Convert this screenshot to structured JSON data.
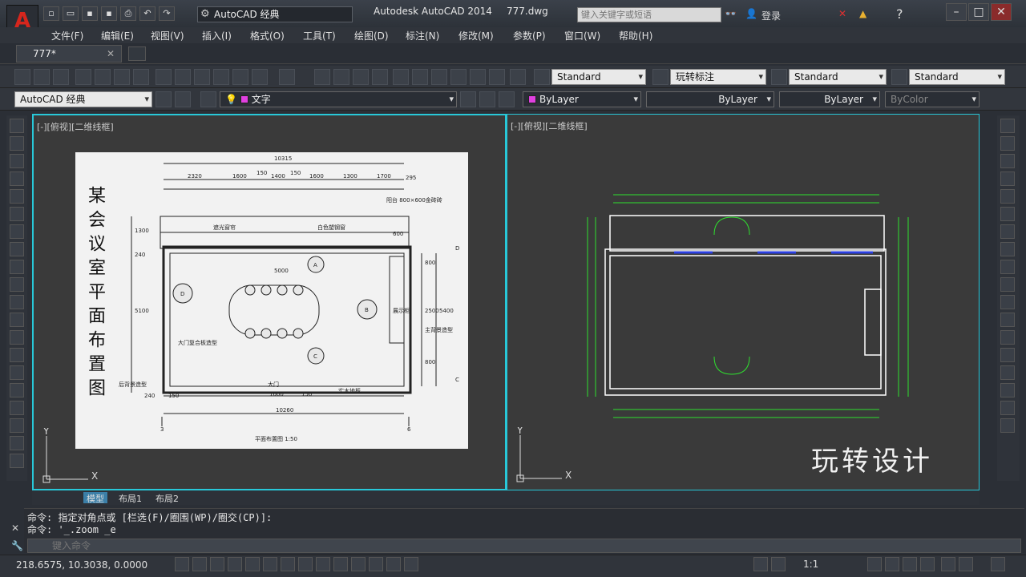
{
  "title": {
    "app": "Autodesk AutoCAD 2014",
    "file": "777.dwg"
  },
  "workspace": "AutoCAD 经典",
  "search": {
    "placeholder": "键入关键字或短语"
  },
  "login": "登录",
  "menu": [
    "文件(F)",
    "编辑(E)",
    "视图(V)",
    "插入(I)",
    "格式(O)",
    "工具(T)",
    "绘图(D)",
    "标注(N)",
    "修改(M)",
    "参数(P)",
    "窗口(W)",
    "帮助(H)"
  ],
  "doc_tab": "777*",
  "toolbar1": {
    "text_style": "Standard",
    "dim_style": "玩转标注",
    "table_style": "Standard",
    "mleader_style": "Standard"
  },
  "toolbar2": {
    "workspace": "AutoCAD 经典",
    "layer": "文字",
    "color": "ByLayer",
    "linetype": "ByLayer",
    "lineweight": "ByLayer",
    "plotstyle": "ByColor"
  },
  "viewport_left": {
    "label": "[-][俯视][二维线框]"
  },
  "viewport_right": {
    "label": "[-][俯视][二维线框]"
  },
  "plan": {
    "title_vertical": "某会议室平面布置图",
    "caption": "平面布置图 1:50",
    "dims_top": [
      "10315",
      "2320",
      "1600",
      "150",
      "1400",
      "150",
      "1600",
      "1300",
      "1700",
      "295"
    ],
    "dims_bottom": [
      "10260",
      "150",
      "1600",
      "150"
    ],
    "dims_left": [
      "1300",
      "240",
      "5100"
    ],
    "dims_right": [
      "800",
      "2500",
      "800",
      "5400"
    ],
    "notes": [
      "阳台 800×600金砖砖",
      "遮光窗帘",
      "白色塑钢窗",
      "600",
      "5000",
      "展示柜",
      "主背景造型",
      "后背景造型",
      "实木地板",
      "大门",
      "大门复合板造型",
      "240"
    ],
    "markers": [
      "A",
      "B",
      "C",
      "D"
    ],
    "grid": [
      "3",
      "6",
      "D",
      "C"
    ]
  },
  "watermark": "玩转设计",
  "layout_tabs": [
    "模型",
    "布局1",
    "布局2"
  ],
  "command_history": [
    "命令: 指定对角点或 [栏选(F)/圈围(WP)/圈交(CP)]:",
    "命令: '_.zoom _e"
  ],
  "command_placeholder": "键入命令",
  "coords": "218.6575, 10.3038, 0.0000",
  "scale": "1:1",
  "colors": {
    "viewport_border": "#28c8d8",
    "dim_lines": "#2fe02f",
    "walls": "#ffffff",
    "window": "#2b3fe0",
    "accent_text": "#e040e0"
  }
}
